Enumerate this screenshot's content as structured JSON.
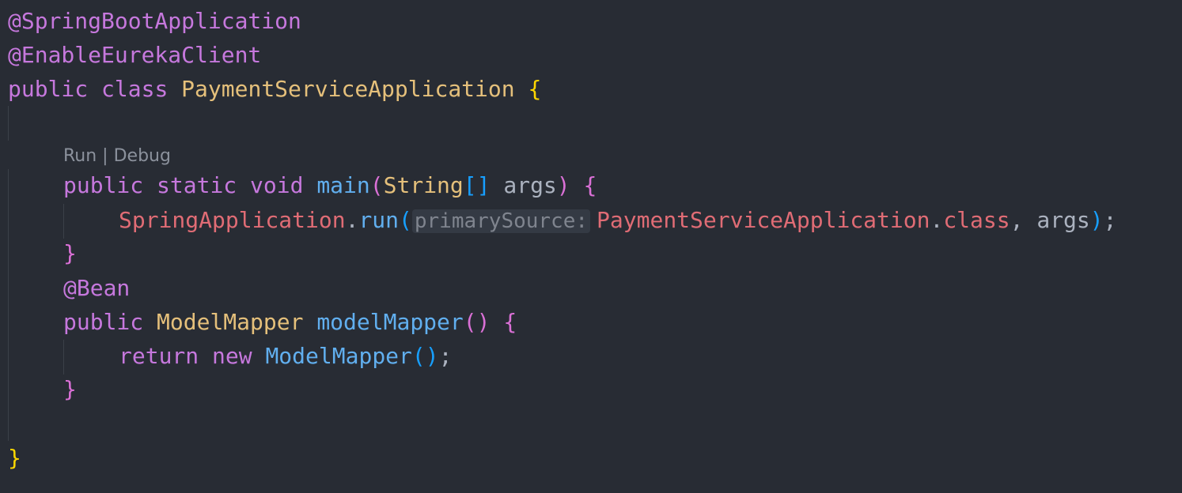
{
  "code": {
    "line1": {
      "annotation": "@SpringBootApplication"
    },
    "line2": {
      "annotation": "@EnableEurekaClient"
    },
    "line3": {
      "public": "public",
      "class": "class",
      "name": "PaymentServiceApplication",
      "brace": "{"
    },
    "codelens": {
      "run": "Run",
      "separator": " | ",
      "debug": "Debug"
    },
    "line5": {
      "public": "public",
      "static": "static",
      "void": "void",
      "method": "main",
      "open_paren": "(",
      "type": "String",
      "brackets": "[]",
      "param": "args",
      "close_paren": ")",
      "brace": "{"
    },
    "line6": {
      "receiver": "SpringApplication",
      "dot": ".",
      "method": "run",
      "open_paren": "(",
      "hint": "primarySource:",
      "arg1": "PaymentServiceApplication",
      "dot2": ".",
      "class_kw": "class",
      "comma": ",",
      "arg2": "args",
      "close_paren": ")",
      "semicolon": ";"
    },
    "line7": {
      "brace": "}"
    },
    "line8": {
      "annotation": "@Bean"
    },
    "line9": {
      "public": "public",
      "type": "ModelMapper",
      "method": "modelMapper",
      "parens": "()",
      "brace": "{"
    },
    "line10": {
      "return": "return",
      "new": "new",
      "ctor": "ModelMapper",
      "parens": "()",
      "semicolon": ";"
    },
    "line11": {
      "brace": "}"
    },
    "line13": {
      "brace": "}"
    }
  },
  "colors": {
    "background": "#282c34",
    "keyword": "#c678dd",
    "type": "#e5c07b",
    "function": "#61afef",
    "variable": "#e06c75",
    "plain": "#abb2bf",
    "bracket_level1": "#ffd700",
    "bracket_level2": "#da70d6",
    "bracket_level3": "#179fff"
  }
}
